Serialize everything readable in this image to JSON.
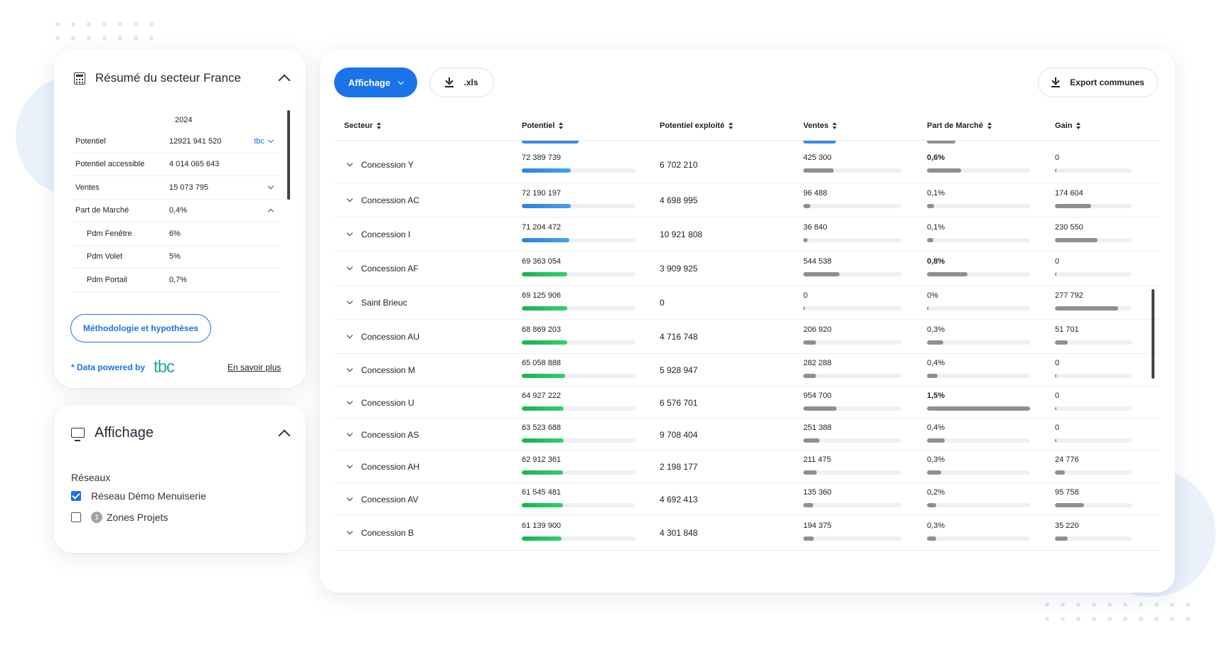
{
  "summary": {
    "title": "Résumé du secteur France",
    "year": "2024",
    "rows": [
      {
        "label": "Potentiel",
        "value": "12921 941 520",
        "extra": "tbc",
        "toggle": "down",
        "sub": false
      },
      {
        "label": "Potentiel accessible",
        "value": "4 014 065 643",
        "extra": "",
        "toggle": "",
        "sub": false
      },
      {
        "label": "Ventes",
        "value": "15 073 795",
        "extra": "",
        "toggle": "down",
        "sub": false
      },
      {
        "label": "Part de Marché",
        "value": "0,4%",
        "extra": "",
        "toggle": "up",
        "sub": false
      },
      {
        "label": "Pdm Fenêtre",
        "value": "6%",
        "extra": "",
        "toggle": "",
        "sub": true
      },
      {
        "label": "Pdm Volet",
        "value": "5%",
        "extra": "",
        "toggle": "",
        "sub": true
      },
      {
        "label": "Pdm Portail",
        "value": "0,7%",
        "extra": "",
        "toggle": "",
        "sub": true
      }
    ],
    "method_button": "Méthodologie et hypothèses",
    "powered_by": "* Data powered by",
    "logo_text": "tbc",
    "learn_more": "En savoir plus"
  },
  "display": {
    "title": "Affichage",
    "section": "Réseaux",
    "options": [
      {
        "label": "Réseau Démo Menuiserie",
        "checked": true,
        "badge": ""
      },
      {
        "label": "Zones Projets",
        "checked": false,
        "badge": "1"
      }
    ]
  },
  "toolbar": {
    "display_button": "Affichage",
    "xls_button": ".xls",
    "export_button": "Export communes"
  },
  "table": {
    "columns": [
      "Secteur",
      "Potentiel",
      "Potentiel exploité",
      "Ventes",
      "Part de Marché",
      "Gain"
    ],
    "rows": [
      {
        "secteur": "Concession Y",
        "potentiel": "72 389 739",
        "pot_bar": 0.43,
        "pot_color": "blue",
        "exploite": "6 702 210",
        "ventes": "425 300",
        "ven_bar": 0.31,
        "part": "0,6%",
        "part_bold": true,
        "part_bar": 0.33,
        "gain": "0",
        "gain_bar": 0.01
      },
      {
        "secteur": "Concession AC",
        "potentiel": "72 190 197",
        "pot_bar": 0.43,
        "pot_color": "blue",
        "exploite": "4 698 995",
        "ventes": "96 488",
        "ven_bar": 0.07,
        "part": "0,1%",
        "part_bold": false,
        "part_bar": 0.07,
        "gain": "174 604",
        "gain_bar": 0.47
      },
      {
        "secteur": "Concession I",
        "potentiel": "71 204 472",
        "pot_bar": 0.42,
        "pot_color": "blue",
        "exploite": "10 921 808",
        "ventes": "36 840",
        "ven_bar": 0.04,
        "part": "0,1%",
        "part_bold": false,
        "part_bar": 0.06,
        "gain": "230 550",
        "gain_bar": 0.56
      },
      {
        "secteur": "Concession AF",
        "potentiel": "69 363 054",
        "pot_bar": 0.4,
        "pot_color": "green",
        "exploite": "3 909 925",
        "ventes": "544 538",
        "ven_bar": 0.37,
        "part": "0,8%",
        "part_bold": true,
        "part_bar": 0.39,
        "gain": "0",
        "gain_bar": 0.01
      },
      {
        "secteur": "Saint Brieuc",
        "potentiel": "69 125 906",
        "pot_bar": 0.4,
        "pot_color": "green",
        "exploite": "0",
        "ventes": "0",
        "ven_bar": 0.01,
        "part": "0%",
        "part_bold": false,
        "part_bar": 0.01,
        "gain": "277 792",
        "gain_bar": 0.82
      },
      {
        "secteur": "Concession AU",
        "potentiel": "68 869 203",
        "pot_bar": 0.4,
        "pot_color": "green",
        "exploite": "4 716 748",
        "ventes": "206 920",
        "ven_bar": 0.13,
        "part": "0,3%",
        "part_bold": false,
        "part_bar": 0.16,
        "gain": "51 701",
        "gain_bar": 0.17
      },
      {
        "secteur": "Concession M",
        "potentiel": "65 058 888",
        "pot_bar": 0.38,
        "pot_color": "green",
        "exploite": "5 928 947",
        "ventes": "282 288",
        "ven_bar": 0.13,
        "part": "0,4%",
        "part_bold": false,
        "part_bar": 0.1,
        "gain": "0",
        "gain_bar": 0.01
      },
      {
        "secteur": "Concession U",
        "potentiel": "64 927 222",
        "pot_bar": 0.37,
        "pot_color": "green",
        "exploite": "6 576 701",
        "ventes": "954 700",
        "ven_bar": 0.34,
        "part": "1,5%",
        "part_bold": true,
        "part_bar": 1.0,
        "gain": "0",
        "gain_bar": 0.01
      },
      {
        "secteur": "Concession AS",
        "potentiel": "63 523 688",
        "pot_bar": 0.37,
        "pot_color": "green",
        "exploite": "9 708 404",
        "ventes": "251 388",
        "ven_bar": 0.17,
        "part": "0,4%",
        "part_bold": false,
        "part_bar": 0.17,
        "gain": "0",
        "gain_bar": 0.01
      },
      {
        "secteur": "Concession AH",
        "potentiel": "62 912 361",
        "pot_bar": 0.36,
        "pot_color": "green",
        "exploite": "2 198 177",
        "ventes": "211 475",
        "ven_bar": 0.14,
        "part": "0,3%",
        "part_bold": false,
        "part_bar": 0.14,
        "gain": "24 776",
        "gain_bar": 0.13
      },
      {
        "secteur": "Concession AV",
        "potentiel": "61 545 481",
        "pot_bar": 0.36,
        "pot_color": "green",
        "exploite": "4 692 413",
        "ventes": "135 360",
        "ven_bar": 0.1,
        "part": "0,2%",
        "part_bold": false,
        "part_bar": 0.09,
        "gain": "95 758",
        "gain_bar": 0.38
      },
      {
        "secteur": "Concession B",
        "potentiel": "61 139 900",
        "pot_bar": 0.35,
        "pot_color": "green",
        "exploite": "4 301 848",
        "ventes": "194 375",
        "ven_bar": 0.11,
        "part": "0,3%",
        "part_bold": false,
        "part_bar": 0.09,
        "gain": "35 220",
        "gain_bar": 0.17
      }
    ]
  },
  "icons": {
    "summary": "calculator-icon",
    "display": "monitor-icon",
    "download": "download-icon",
    "collapse": "chevron-up-icon",
    "expand": "chevron-down-icon",
    "sort": "sort-icon"
  },
  "colors": {
    "accent": "#1a73e8",
    "bar_blue": "#3b8ee8",
    "bar_green": "#22c05e",
    "bar_grey": "#8c9096"
  }
}
